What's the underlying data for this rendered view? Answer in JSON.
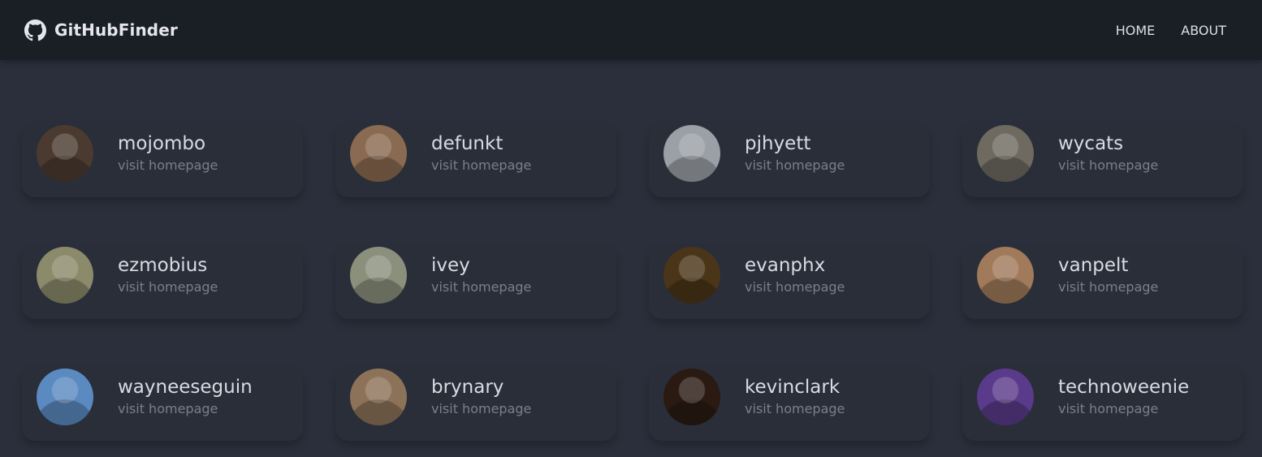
{
  "navbar": {
    "brand": "GitHubFinder",
    "brand_icon": "github-icon",
    "links": [
      {
        "label": "HOME"
      },
      {
        "label": "ABOUT"
      }
    ]
  },
  "users": [
    {
      "login": "mojombo",
      "link_text": "visit homepage",
      "avatar_color": "#4a3a30"
    },
    {
      "login": "defunkt",
      "link_text": "visit homepage",
      "avatar_color": "#8a6a50"
    },
    {
      "login": "pjhyett",
      "link_text": "visit homepage",
      "avatar_color": "#9ba0a6"
    },
    {
      "login": "wycats",
      "link_text": "visit homepage",
      "avatar_color": "#6e6a60"
    },
    {
      "login": "ezmobius",
      "link_text": "visit homepage",
      "avatar_color": "#8b8a6a"
    },
    {
      "login": "ivey",
      "link_text": "visit homepage",
      "avatar_color": "#8a907c"
    },
    {
      "login": "evanphx",
      "link_text": "visit homepage",
      "avatar_color": "#4a3518"
    },
    {
      "login": "vanpelt",
      "link_text": "visit homepage",
      "avatar_color": "#a07a5a"
    },
    {
      "login": "wayneeseguin",
      "link_text": "visit homepage",
      "avatar_color": "#5b8ac0"
    },
    {
      "login": "brynary",
      "link_text": "visit homepage",
      "avatar_color": "#8c7258"
    },
    {
      "login": "kevinclark",
      "link_text": "visit homepage",
      "avatar_color": "#2a1a12"
    },
    {
      "login": "technoweenie",
      "link_text": "visit homepage",
      "avatar_color": "#5a3a8a"
    }
  ]
}
